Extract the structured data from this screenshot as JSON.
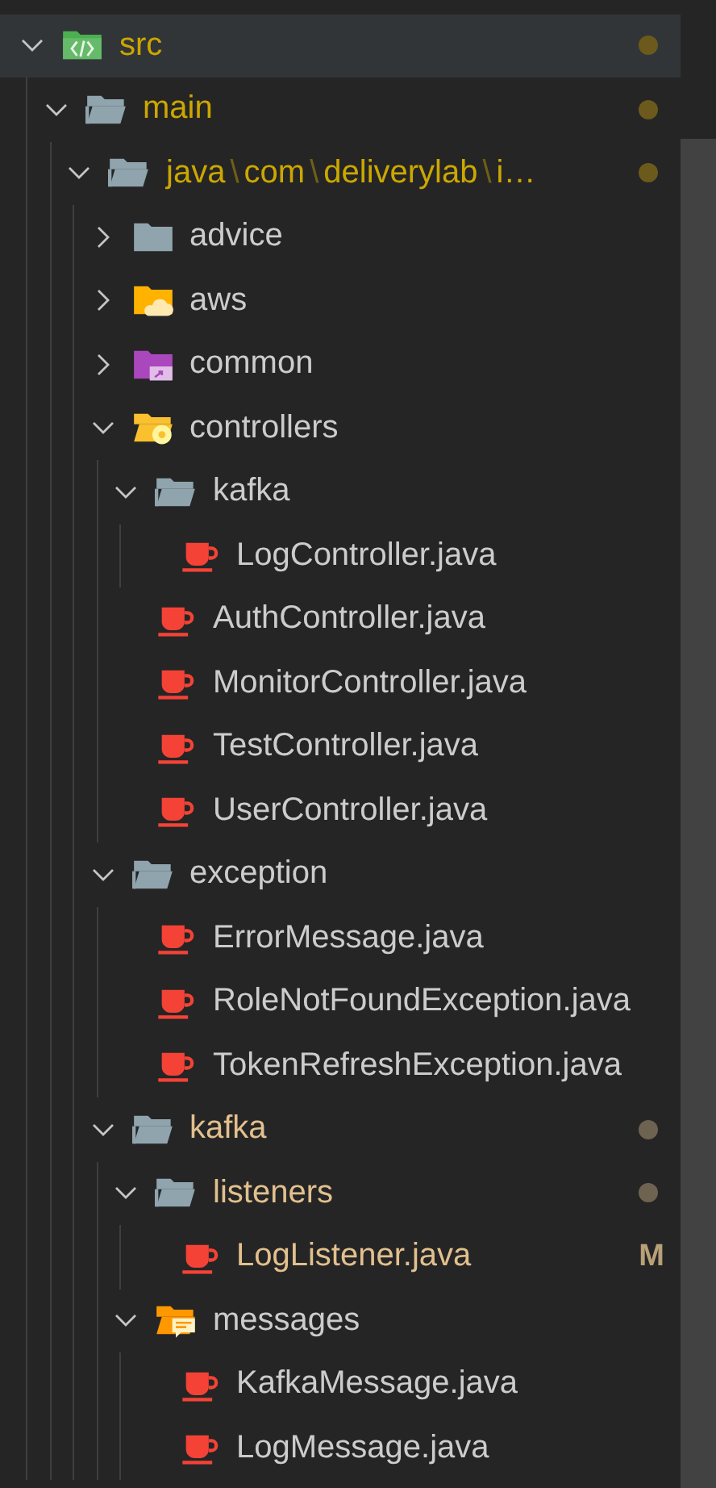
{
  "explorer": {
    "tree": [
      {
        "kind": "source-folder",
        "label": "src",
        "expanded": true,
        "selected": true,
        "color": "#cca700",
        "decoration": {
          "kind": "dot",
          "color": "#6b5a1b"
        },
        "children": [
          {
            "kind": "folder",
            "label": "main",
            "expanded": true,
            "selected": false,
            "color": "#cca700",
            "decoration": {
              "kind": "dot",
              "color": "#6b5a1b"
            },
            "children": [
              {
                "kind": "folder",
                "segments": [
                  {
                    "kind": "name",
                    "text": "java"
                  },
                  {
                    "kind": "separator",
                    "text": "\\"
                  },
                  {
                    "kind": "name",
                    "text": "com"
                  },
                  {
                    "kind": "separator",
                    "text": "\\"
                  },
                  {
                    "kind": "name",
                    "text": "deliverylab"
                  },
                  {
                    "kind": "separator",
                    "text": "\\"
                  },
                  {
                    "kind": "name",
                    "text": "i…"
                  }
                ],
                "expanded": true,
                "selected": false,
                "color": "#cca700",
                "decoration": {
                  "kind": "dot",
                  "color": "#6b5a1b"
                },
                "children": [
                  {
                    "kind": "folder",
                    "label": "advice",
                    "expanded": false,
                    "selected": false
                  },
                  {
                    "kind": "cloud-folder",
                    "label": "aws",
                    "expanded": false,
                    "selected": false
                  },
                  {
                    "kind": "shared-folder",
                    "label": "common",
                    "expanded": false,
                    "selected": false
                  },
                  {
                    "kind": "gear-folder",
                    "label": "controllers",
                    "expanded": true,
                    "selected": false,
                    "children": [
                      {
                        "kind": "folder",
                        "label": "kafka",
                        "expanded": true,
                        "selected": false,
                        "children": [
                          {
                            "kind": "java-file",
                            "label": "LogController.java",
                            "selected": false
                          }
                        ]
                      },
                      {
                        "kind": "java-file",
                        "label": "AuthController.java",
                        "selected": false
                      },
                      {
                        "kind": "java-file",
                        "label": "MonitorController.java",
                        "selected": false
                      },
                      {
                        "kind": "java-file",
                        "label": "TestController.java",
                        "selected": false
                      },
                      {
                        "kind": "java-file",
                        "label": "UserController.java",
                        "selected": false
                      }
                    ]
                  },
                  {
                    "kind": "folder",
                    "label": "exception",
                    "expanded": true,
                    "selected": false,
                    "children": [
                      {
                        "kind": "java-file",
                        "label": "ErrorMessage.java",
                        "selected": false
                      },
                      {
                        "kind": "java-file",
                        "label": "RoleNotFoundException.java",
                        "selected": false
                      },
                      {
                        "kind": "java-file",
                        "label": "TokenRefreshException.java",
                        "selected": false
                      }
                    ]
                  },
                  {
                    "kind": "folder",
                    "label": "kafka",
                    "expanded": true,
                    "selected": false,
                    "color": "#e2c08d",
                    "decoration": {
                      "kind": "dot",
                      "color": "#6e6350"
                    },
                    "children": [
                      {
                        "kind": "folder",
                        "label": "listeners",
                        "expanded": true,
                        "selected": false,
                        "color": "#e2c08d",
                        "decoration": {
                          "kind": "dot",
                          "color": "#6e6350"
                        },
                        "children": [
                          {
                            "kind": "java-file",
                            "label": "LogListener.java",
                            "selected": false,
                            "color": "#e2c08d",
                            "decoration": {
                              "kind": "letter",
                              "text": "M"
                            }
                          }
                        ]
                      },
                      {
                        "kind": "chat-folder",
                        "label": "messages",
                        "expanded": true,
                        "selected": false,
                        "children": [
                          {
                            "kind": "java-file",
                            "label": "KafkaMessage.java",
                            "selected": false
                          },
                          {
                            "kind": "java-file",
                            "label": "LogMessage.java",
                            "selected": false
                          }
                        ]
                      }
                    ]
                  }
                ]
              }
            ]
          }
        ]
      }
    ]
  }
}
